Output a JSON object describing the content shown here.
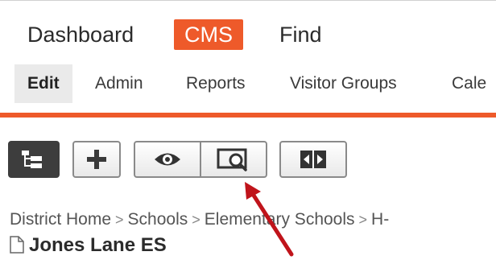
{
  "top_nav": {
    "dashboard": "Dashboard",
    "cms": "CMS",
    "find": "Find"
  },
  "sub_nav": {
    "edit": "Edit",
    "admin": "Admin",
    "reports": "Reports",
    "visitor_groups": "Visitor Groups",
    "cale": "Cale"
  },
  "toolbar": {
    "icons": [
      "tree-view-icon",
      "plus-icon",
      "eye-icon",
      "preview-magnifier-icon",
      "compare-arrows-icon"
    ]
  },
  "breadcrumb": {
    "items": [
      "District Home",
      "Schools",
      "Elementary Schools",
      "H-"
    ],
    "separator": ">"
  },
  "page": {
    "title": "Jones Lane ES"
  },
  "colors": {
    "accent": "#ee5a2a",
    "annotation_arrow": "#c0141b"
  }
}
